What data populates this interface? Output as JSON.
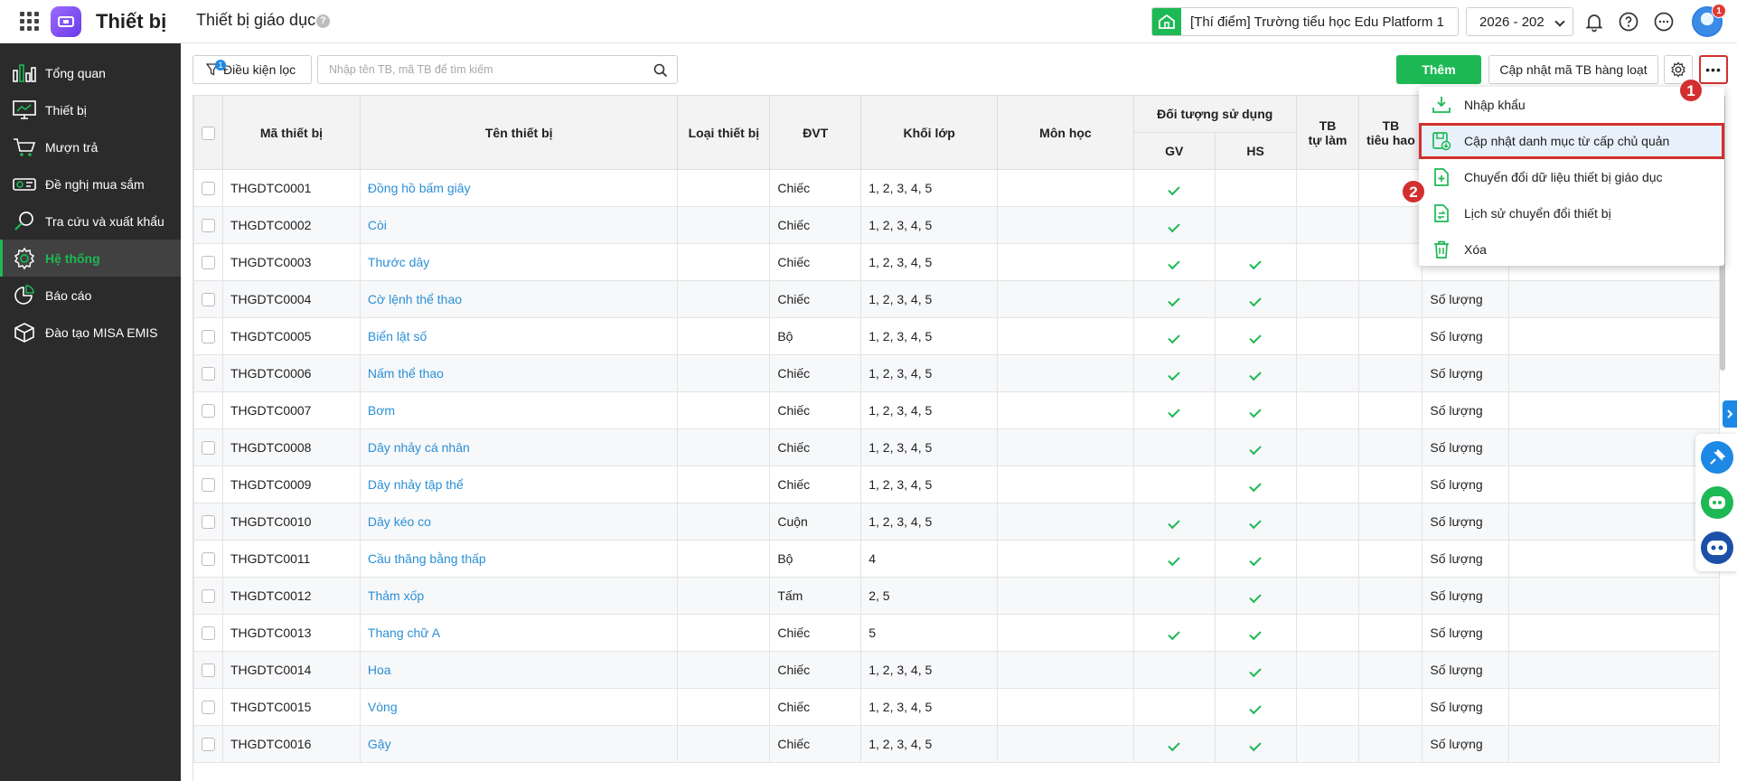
{
  "header": {
    "app_title": "Thiết bị",
    "page_title": "Thiết bị giáo dục",
    "help_mark": "?",
    "school": "[Thí điểm] Trường tiểu học Edu Platform 1",
    "year": "2026 - 202",
    "avatar_badge": "1"
  },
  "sidebar": {
    "items": [
      {
        "label": "Tổng quan",
        "icon": "chart-icon"
      },
      {
        "label": "Thiết bị",
        "icon": "monitor-icon"
      },
      {
        "label": "Mượn trả",
        "icon": "cart-icon"
      },
      {
        "label": "Đề nghị mua sắm",
        "icon": "projector-icon"
      },
      {
        "label": "Tra cứu và xuất khẩu",
        "icon": "search-icon"
      },
      {
        "label": "Hệ thống",
        "icon": "gear-icon",
        "active": true
      },
      {
        "label": "Báo cáo",
        "icon": "pie-icon"
      },
      {
        "label": "Đào tạo MISA EMIS",
        "icon": "cube-icon"
      }
    ]
  },
  "toolbar": {
    "filter_label": "Điều kiện lọc",
    "filter_badge": "1",
    "search_placeholder": "Nhập tên TB, mã TB để tìm kiếm",
    "add_label": "Thêm",
    "bulk_label": "Cập nhật mã TB hàng loạt",
    "more_label": "•••"
  },
  "steps": {
    "one": "1",
    "two": "2"
  },
  "menu": {
    "items": [
      {
        "label": "Nhập khẩu",
        "icon": "import-icon"
      },
      {
        "label": "Cập nhật danh mục từ cấp chủ quản",
        "icon": "update-catalog-icon",
        "highlight": true
      },
      {
        "label": "Chuyển đổi dữ liệu thiết bị giáo dục",
        "icon": "convert-icon"
      },
      {
        "label": "Lịch sử chuyển đổi thiết bị",
        "icon": "history-icon"
      },
      {
        "label": "Xóa",
        "icon": "trash-icon"
      }
    ]
  },
  "table": {
    "headers": {
      "code": "Mã thiết bị",
      "name": "Tên thiết bị",
      "type": "Loại thiết bị",
      "unit": "ĐVT",
      "grade": "Khối lớp",
      "subject": "Môn học",
      "target": "Đối tượng sử dụng",
      "gv": "GV",
      "hs": "HS",
      "self_made_1": "TB",
      "self_made_2": "tự làm",
      "consumable_1": "TB",
      "consumable_2": "tiêu hao"
    },
    "rows": [
      {
        "code": "THGDTC0001",
        "name": "Đồng hồ bấm giây",
        "unit": "Chiếc",
        "grade": "1, 2, 3, 4, 5",
        "gv": true,
        "hs": false,
        "qty": ""
      },
      {
        "code": "THGDTC0002",
        "name": "Còi",
        "unit": "Chiếc",
        "grade": "1, 2, 3, 4, 5",
        "gv": true,
        "hs": false,
        "qty": ""
      },
      {
        "code": "THGDTC0003",
        "name": "Thước dây",
        "unit": "Chiếc",
        "grade": "1, 2, 3, 4, 5",
        "gv": true,
        "hs": true,
        "qty": ""
      },
      {
        "code": "THGDTC0004",
        "name": "Cờ lệnh thể thao",
        "unit": "Chiếc",
        "grade": "1, 2, 3, 4, 5",
        "gv": true,
        "hs": true,
        "qty": "Số lượng"
      },
      {
        "code": "THGDTC0005",
        "name": "Biển lật số",
        "unit": "Bộ",
        "grade": "1, 2, 3, 4, 5",
        "gv": true,
        "hs": true,
        "qty": "Số lượng"
      },
      {
        "code": "THGDTC0006",
        "name": "Nấm thể thao",
        "unit": "Chiếc",
        "grade": "1, 2, 3, 4, 5",
        "gv": true,
        "hs": true,
        "qty": "Số lượng"
      },
      {
        "code": "THGDTC0007",
        "name": "Bơm",
        "unit": "Chiếc",
        "grade": "1, 2, 3, 4, 5",
        "gv": true,
        "hs": true,
        "qty": "Số lượng"
      },
      {
        "code": "THGDTC0008",
        "name": "Dây nhảy cá nhân",
        "unit": "Chiếc",
        "grade": "1, 2, 3, 4, 5",
        "gv": false,
        "hs": true,
        "qty": "Số lượng"
      },
      {
        "code": "THGDTC0009",
        "name": "Dây nhảy tập thể",
        "unit": "Chiếc",
        "grade": "1, 2, 3, 4, 5",
        "gv": false,
        "hs": true,
        "qty": "Số lượng"
      },
      {
        "code": "THGDTC0010",
        "name": "Dây kéo co",
        "unit": "Cuộn",
        "grade": "1, 2, 3, 4, 5",
        "gv": true,
        "hs": true,
        "qty": "Số lượng"
      },
      {
        "code": "THGDTC0011",
        "name": "Cầu thăng bằng thấp",
        "unit": "Bộ",
        "grade": "4",
        "gv": true,
        "hs": true,
        "qty": "Số lượng"
      },
      {
        "code": "THGDTC0012",
        "name": "Thảm xốp",
        "unit": "Tấm",
        "grade": "2, 5",
        "gv": false,
        "hs": true,
        "qty": "Số lượng"
      },
      {
        "code": "THGDTC0013",
        "name": "Thang chữ A",
        "unit": "Chiếc",
        "grade": "5",
        "gv": true,
        "hs": true,
        "qty": "Số lượng"
      },
      {
        "code": "THGDTC0014",
        "name": "Hoa",
        "unit": "Chiếc",
        "grade": "1, 2, 3, 4, 5",
        "gv": false,
        "hs": true,
        "qty": "Số lượng"
      },
      {
        "code": "THGDTC0015",
        "name": "Vòng",
        "unit": "Chiếc",
        "grade": "1, 2, 3, 4, 5",
        "gv": false,
        "hs": true,
        "qty": "Số lượng"
      },
      {
        "code": "THGDTC0016",
        "name": "Gậy",
        "unit": "Chiếc",
        "grade": "1, 2, 3, 4, 5",
        "gv": true,
        "hs": true,
        "qty": "Số lượng"
      }
    ]
  },
  "colors": {
    "accent": "#1db954",
    "link": "#2b8fd6",
    "alert": "#d32f2f",
    "sidebar": "#2b2b2b"
  }
}
